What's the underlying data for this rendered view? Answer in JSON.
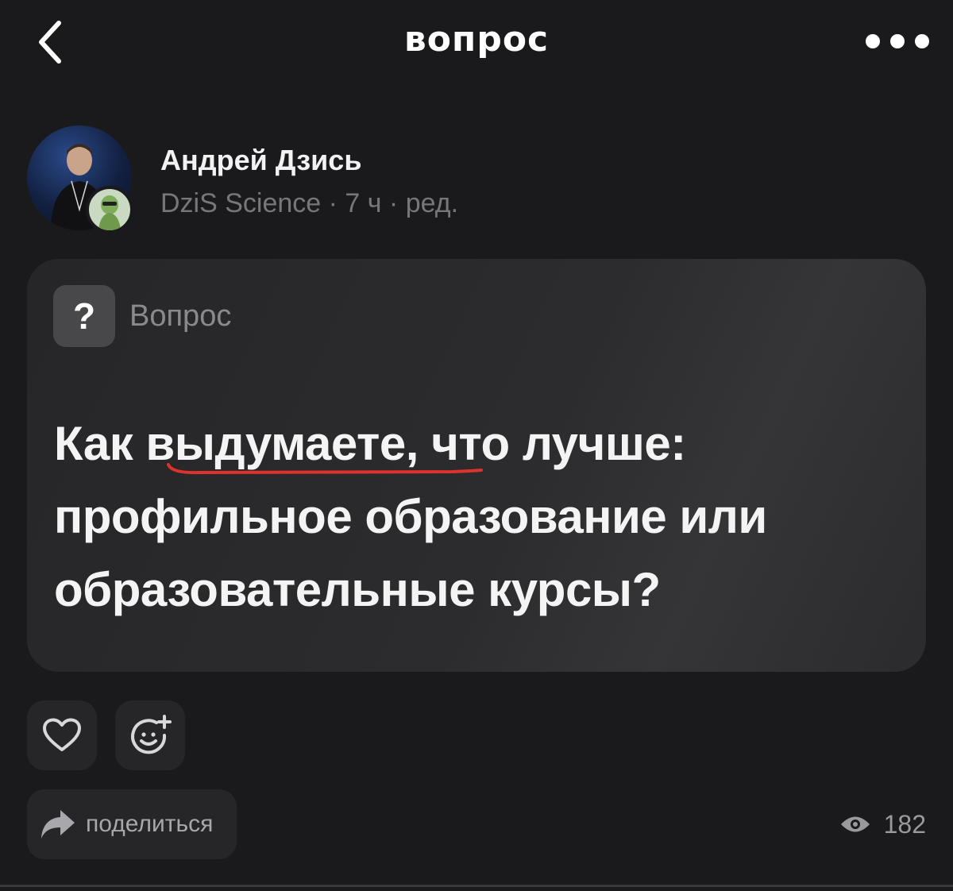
{
  "header": {
    "title": "вопрос",
    "back_icon": "chevron-left-icon",
    "more_icon": "more-dots-icon"
  },
  "author": {
    "name": "Андрей Дзись",
    "meta": "DziS Science · 7 ч · ред.",
    "avatar": "avatar",
    "badge": "community-badge"
  },
  "question": {
    "badge_symbol": "?",
    "badge_label": "Вопрос",
    "text": "Как выдумаете, что лучше: профильное образование или образовательные курсы?",
    "annotation_color": "#e0322c"
  },
  "actions": {
    "like_icon": "heart-icon",
    "reaction_icon": "add-emoji-icon",
    "share_icon": "share-arrow-icon",
    "share_label": "поделиться",
    "views_icon": "eye-icon",
    "views_count": "182"
  },
  "colors": {
    "background": "#1a1a1c",
    "card": "#2c2c2e",
    "muted_text": "#77777b"
  }
}
